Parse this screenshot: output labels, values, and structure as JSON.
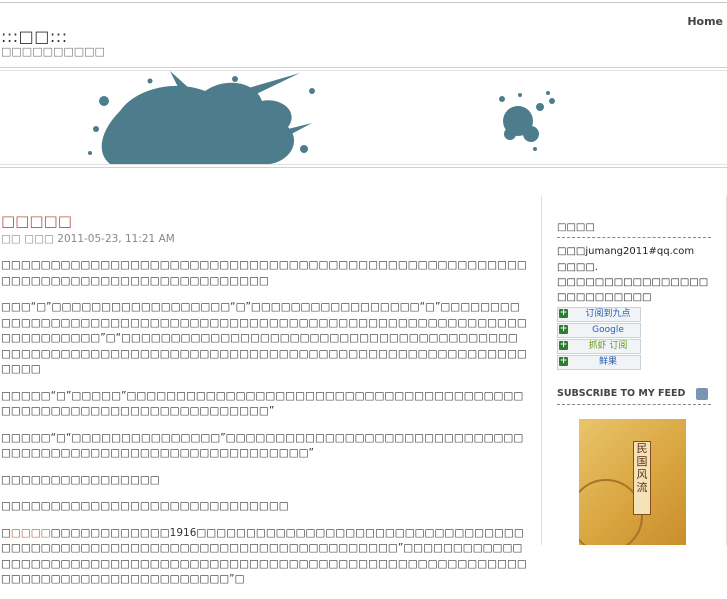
{
  "header": {
    "home_label": "Home",
    "site_title": ":::□□:::",
    "site_subtitle": "□□□□□□□□□□"
  },
  "banner": {
    "splash_color": "#4d7d8c"
  },
  "post": {
    "title": "□□□□□",
    "meta": "□□ □□□ 2011-05-23, 11:21 AM",
    "paragraphs": [
      "□□□□□□□□□□□□□□□□□□□□□□□□□□□□□□□□□□□□□□□□□□□□□□□□□□□□□□□□□□□□□□□□□□□□□□□□□□□□□□□□",
      "□□□“□”□□□□□□□□□□□□□□□□□□“□”□□□□□□□□□□□□□□□□□“□”□□□□□□□□□□□□□□□□□□□□□□□□□□□□□□□□□□□□□□□□□□□□□□□□□□□□□□□□□□□□□□□□□□□□□□□”□“□□□□□□□□□□□□□□□□□□□□□□□□□□□□□□□□□□□□□□□□□□□□□□□□□□□□□□□□□□□□□□□□□□□□□□□□□□□□□□□□□□□□□□□□□□□□□□□□□",
      "□□□□□“□”□□□□□”□□□□□□□□□□□□□□□□□□□□□□□□□□□□□□□□□□□□□□□□□□□□□□□□□□□□□□□□□□□□□□□□□□□”",
      "□□□□□“□“□□□□□□□□□□□□□□□”□□□□□□□□□□□□□□□□□□□□□□□□□□□□□□□□□□□□□□□□□□□□□□□□□□□□□□□□□□□□□”",
      "□□□□□□□□□□□□□□□□",
      "□□□□□□□□□□□□□□□□□□□□□□□□□□□□□",
      "□□□□□□□□□□□□□□□□□□□□□□□□□□□□□□□□□□□□□□□□□□□□□□□□□□□□□□□□□□□□□□□□□□□□□□□□□□□□□□□□□□□□□□□□□□□□□□”□"
    ],
    "p7_prefix": "□",
    "p7_link": "□□□□",
    "p7_mid": "□□□□□□□□□□□□1916□□□□□□□□□□□□□□□□□□□□□□□□□□□□□□□□□□□□□□□□□□□□□□□□□□□□□□□□□□□□□□□□□□□□□□□□□”□□□□□□□□□□□□□□□□□□□□□□□□□□□□□□□□□□□□□□□□□□□□□□□□□□□□□□□□□□□□□□□□□□□□□□□□□□□□□□□□□□□□□□□□”□"
  },
  "sidebar": {
    "contact_heading": "□□□□",
    "contact_email": "□□□jumang2011#qq.com",
    "contact_note_label": "□□□□.",
    "contact_note": "□□□□□□□□□□□□□□□□□□□□□□□□□□",
    "feed_buttons": [
      "订阅到九点",
      "Google",
      "抓虾 订阅",
      "鲜果"
    ],
    "subscribe_heading": "SUBSCRIBE TO MY FEED",
    "book_title": "民国风流"
  }
}
